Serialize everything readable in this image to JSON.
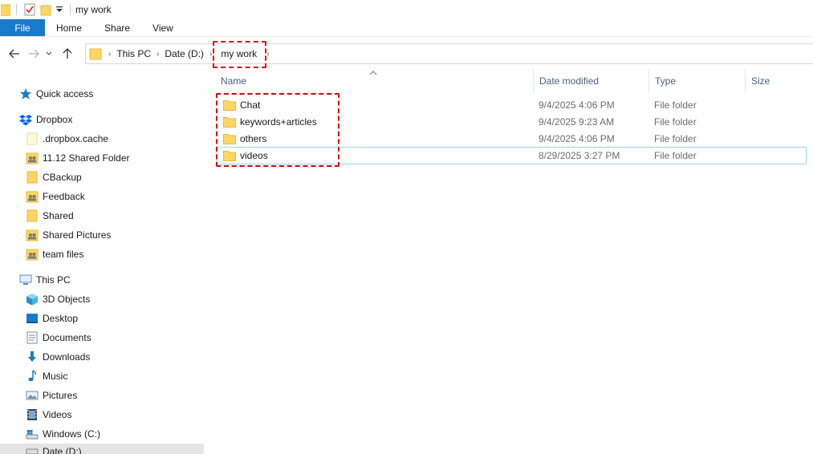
{
  "window": {
    "title": "my work"
  },
  "ribbon": {
    "tabs": [
      {
        "label": "File"
      },
      {
        "label": "Home"
      },
      {
        "label": "Share"
      },
      {
        "label": "View"
      }
    ]
  },
  "address": {
    "crumbs": [
      "This PC",
      "Date (D:)",
      "my work"
    ]
  },
  "sidebar": {
    "quick_access": "Quick access",
    "dropbox": "Dropbox",
    "dropbox_items": [
      ".dropbox.cache",
      "11.12 Shared Folder",
      "CBackup",
      "Feedback",
      "Shared",
      "Shared Pictures",
      "team files"
    ],
    "this_pc": "This PC",
    "pc_items": [
      "3D Objects",
      "Desktop",
      "Documents",
      "Downloads",
      "Music",
      "Pictures",
      "Videos",
      "Windows (C:)",
      "Date (D:)"
    ]
  },
  "columns": {
    "name": "Name",
    "date": "Date modified",
    "type": "Type",
    "size": "Size"
  },
  "files": [
    {
      "name": "Chat",
      "date": "9/4/2025 4:06 PM",
      "type": "File folder"
    },
    {
      "name": "keywords+articles",
      "date": "9/4/2025 9:23 AM",
      "type": "File folder"
    },
    {
      "name": "others",
      "date": "9/4/2025 4:06 PM",
      "type": "File folder"
    },
    {
      "name": "videos",
      "date": "8/29/2025 3:27 PM",
      "type": "File folder"
    }
  ],
  "colors": {
    "accent": "#1979ca",
    "highlight": "#e00000",
    "folder": "#ffd663",
    "folder_dark": "#e8b93a"
  }
}
